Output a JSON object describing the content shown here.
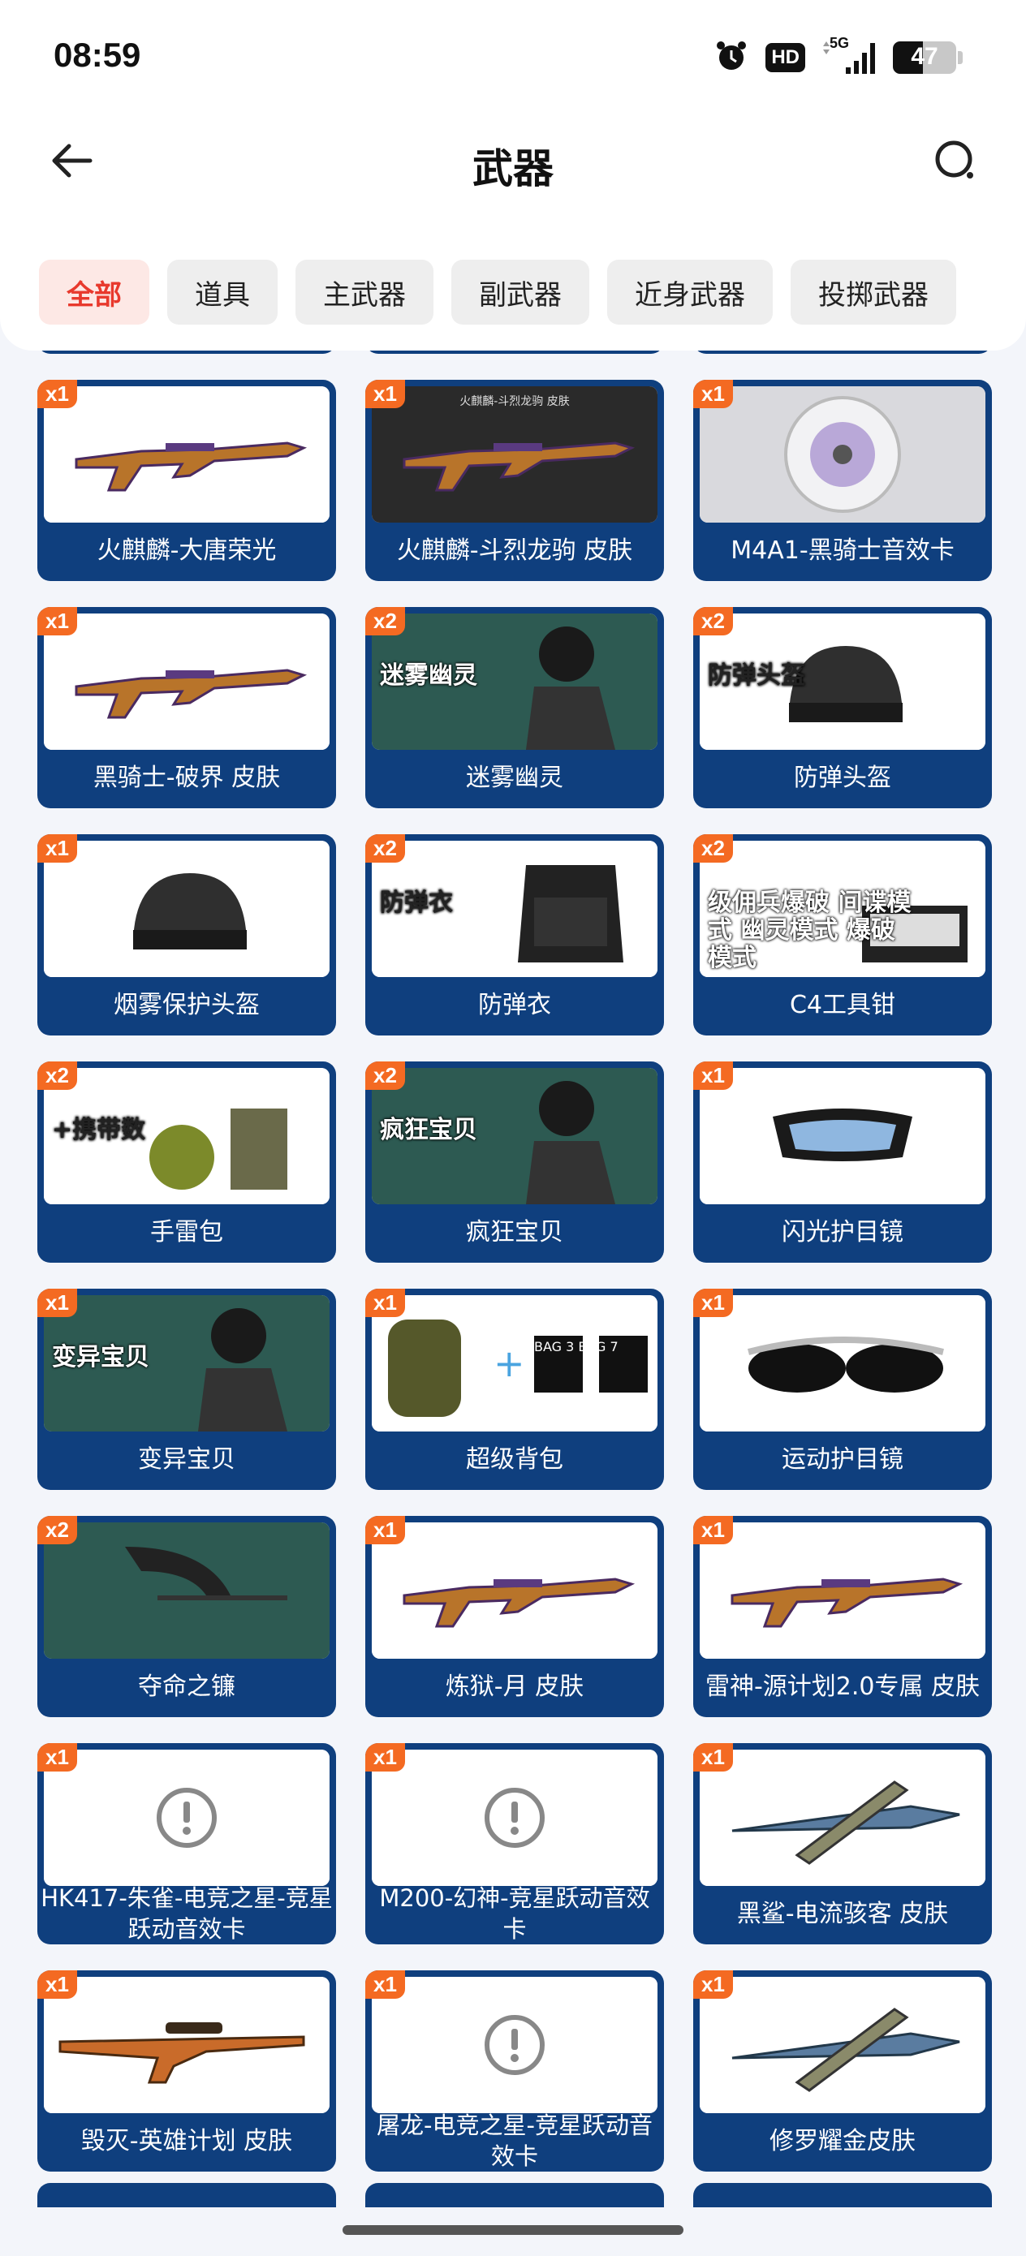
{
  "status_bar": {
    "time": "08:59",
    "hd": "HD",
    "network": "5G",
    "battery": "47",
    "battery_level": 0.47,
    "icons": [
      "alarm-icon",
      "signal-icon",
      "battery-icon"
    ]
  },
  "header": {
    "title": "武器",
    "back_icon": "arrow-left-icon",
    "search_icon": "search-icon"
  },
  "tabs": [
    {
      "label": "全部",
      "active": true
    },
    {
      "label": "道具",
      "active": false
    },
    {
      "label": "主武器",
      "active": false
    },
    {
      "label": "副武器",
      "active": false
    },
    {
      "label": "近身武器",
      "active": false
    },
    {
      "label": "投掷武器",
      "active": false
    }
  ],
  "colors": {
    "card_bg": "#0f3f7e",
    "badge": "#f46a22",
    "active_tab_text": "#e8392d",
    "active_tab_bg": "#fde8e5"
  },
  "items": [
    {
      "qty": "x1",
      "name": "火麒麟-大唐荣光",
      "image": "rifle-image"
    },
    {
      "qty": "x1",
      "name": "火麒麟-斗烈龙驹 皮肤",
      "image": "rifle-image",
      "image_caption": "火麒麟-斗烈龙驹 皮肤"
    },
    {
      "qty": "x1",
      "name": "M4A1-黑骑士音效卡",
      "image": "disc-image"
    },
    {
      "qty": "x1",
      "name": "黑骑士-破界 皮肤",
      "image": "rifle-image"
    },
    {
      "qty": "x2",
      "name": "迷雾幽灵",
      "image": "character-image",
      "image_caption": "迷雾幽灵"
    },
    {
      "qty": "x2",
      "name": "防弹头盔",
      "image": "helmet-image",
      "image_caption": "防弹头盔"
    },
    {
      "qty": "x1",
      "name": "烟雾保护头盔",
      "image": "helmet-image"
    },
    {
      "qty": "x2",
      "name": "防弹衣",
      "image": "vest-image",
      "image_caption": "防弹衣"
    },
    {
      "qty": "x2",
      "name": "C4工具钳",
      "image": "c4-image",
      "image_caption": "级佣兵爆破 间谍模式 幽灵模式 爆破模式"
    },
    {
      "qty": "x2",
      "name": "手雷包",
      "image": "grenade-image",
      "image_caption": "+携带数"
    },
    {
      "qty": "x2",
      "name": "疯狂宝贝",
      "image": "character-image",
      "image_caption": "疯狂宝贝"
    },
    {
      "qty": "x1",
      "name": "闪光护目镜",
      "image": "goggles-image"
    },
    {
      "qty": "x1",
      "name": "变异宝贝",
      "image": "character-image",
      "image_caption": "变异宝贝"
    },
    {
      "qty": "x1",
      "name": "超级背包",
      "image": "backpack-image",
      "image_caption": "BAG 3 BAG 7"
    },
    {
      "qty": "x1",
      "name": "运动护目镜",
      "image": "sunglasses-image"
    },
    {
      "qty": "x2",
      "name": "夺命之镰",
      "image": "scythe-image"
    },
    {
      "qty": "x1",
      "name": "炼狱-月 皮肤",
      "image": "rifle-image"
    },
    {
      "qty": "x1",
      "name": "雷神-源计划2.0专属 皮肤",
      "image": "rifle-image"
    },
    {
      "qty": "x1",
      "name": "HK417-朱雀-电竞之星-竞星跃动音效卡",
      "image": "missing-image-icon"
    },
    {
      "qty": "x1",
      "name": "M200-幻神-竞星跃动音效卡",
      "image": "missing-image-icon"
    },
    {
      "qty": "x1",
      "name": "黑鲨-电流骇客 皮肤",
      "image": "knife-image"
    },
    {
      "qty": "x1",
      "name": "毁灭-英雄计划 皮肤",
      "image": "sniper-image"
    },
    {
      "qty": "x1",
      "name": "屠龙-电竞之星-竞星跃动音效卡",
      "image": "missing-image-icon"
    },
    {
      "qty": "x1",
      "name": "修罗耀金皮肤",
      "image": "knife-image"
    }
  ]
}
